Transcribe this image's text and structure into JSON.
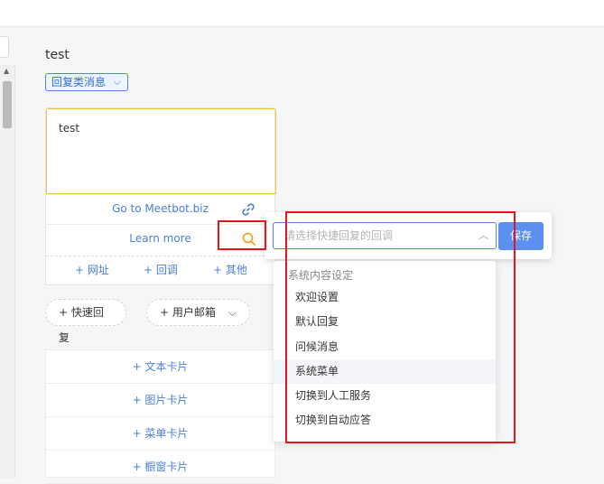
{
  "editor": {
    "title": "test",
    "type_select": "回复类消息",
    "message_text": "test",
    "buttons": [
      "Go to Meetbot.biz",
      "Learn more"
    ],
    "add_options": [
      "+ 网址",
      "+ 回调",
      "+ 其他"
    ],
    "pills": [
      "+ 快速回复",
      "+ 用户邮箱"
    ]
  },
  "card_types": [
    "+ 文本卡片",
    "+ 图片卡片",
    "+ 菜单卡片",
    "+ 橱窗卡片"
  ],
  "callback_popover": {
    "placeholder": "请选择快捷回复的回调",
    "save_label": "保存"
  },
  "dropdown": {
    "group_label": "系统内容设定",
    "options": [
      "欢迎设置",
      "默认回复",
      "问候消息",
      "系统菜单",
      "切换到人工服务",
      "切换到自动应答"
    ],
    "hovered_option": "系统菜单"
  },
  "colors": {
    "accent": "#4a7fd6",
    "highlight": "#e6151c",
    "text_border": "#f0c341",
    "save_button": "#5b8ff0"
  },
  "icons": [
    "chevron-down-icon",
    "link-icon",
    "search-icon",
    "chevron-up-icon"
  ]
}
